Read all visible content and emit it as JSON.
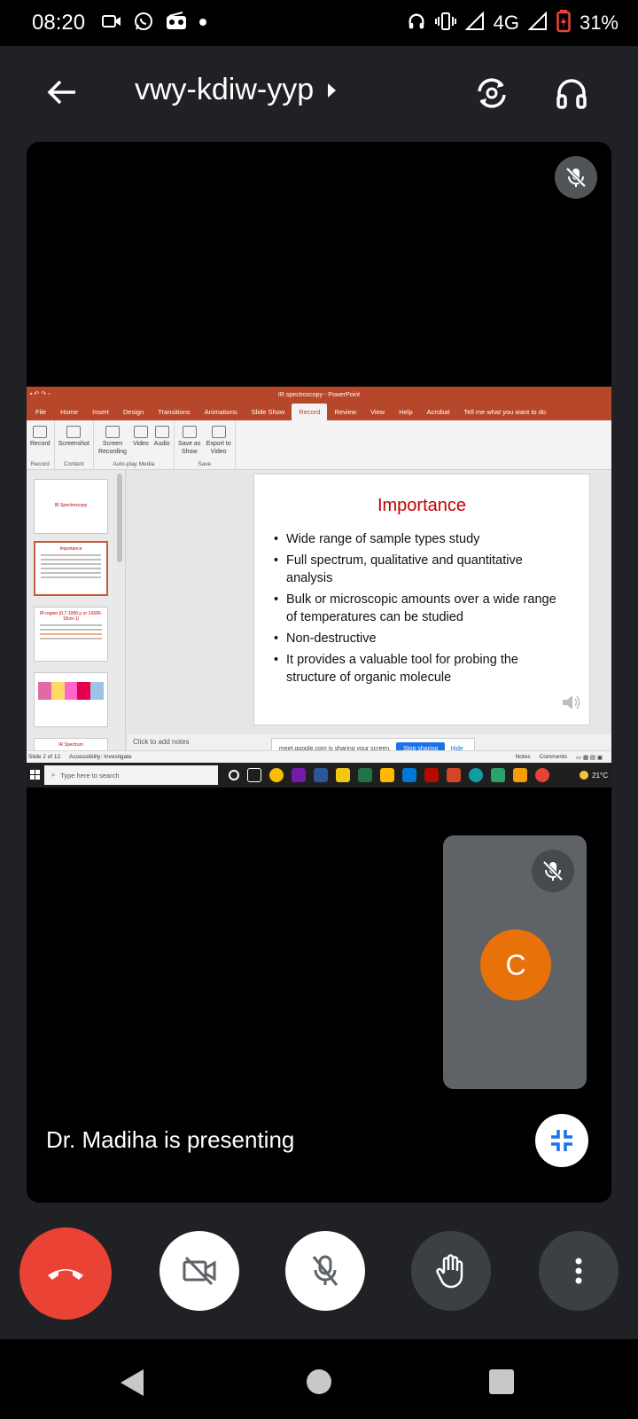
{
  "status": {
    "time": "08:20",
    "network": "4G",
    "battery": "31%"
  },
  "header": {
    "meeting_code": "vwy-kdiw-yyp"
  },
  "shared_screen": {
    "window_title": "IR spectroscopy  -  PowerPoint",
    "menu": [
      "File",
      "Home",
      "Insert",
      "Design",
      "Transitions",
      "Animations",
      "Slide Show",
      "Record",
      "Review",
      "View",
      "Help",
      "Acrobat",
      "Tell me what you want to do"
    ],
    "active_menu": "Record",
    "ribbon": {
      "groups": [
        {
          "label": "Record",
          "buttons": [
            "Record"
          ]
        },
        {
          "label": "Content",
          "buttons": [
            "Screenshot"
          ]
        },
        {
          "label": "Auto-play Media",
          "buttons": [
            "Screen Recording",
            "Video",
            "Audio"
          ]
        },
        {
          "label": "Save",
          "buttons": [
            "Save as Show",
            "Export to Video"
          ]
        }
      ]
    },
    "thumbs": [
      {
        "title": "IR Spectroscopy"
      },
      {
        "title": "Importance"
      },
      {
        "title": "IR region (0.7-1000 μ or 14300-10cm-1)"
      },
      {
        "title": ""
      },
      {
        "title": "IR Spectrum"
      }
    ],
    "slide": {
      "title": "Importance",
      "bullets": [
        " Wide range of sample types study",
        "Full spectrum, qualitative and quantitative analysis",
        " Bulk or microscopic amounts over a wide range of temperatures can be studied",
        "Non-destructive",
        " It provides a valuable tool for probing the structure of organic molecule"
      ]
    },
    "notes_placeholder": "Click to add notes",
    "sharing_text": "meet.google.com is sharing your screen.",
    "stop_sharing": "Stop sharing",
    "hide": "Hide",
    "status_slide": "Slide 2 of 12",
    "status_accessibility": "Accessibility: Investigate",
    "status_notes": "Notes",
    "status_comments": "Comments",
    "taskbar_search": "Type here to search",
    "temperature": "21°C"
  },
  "self_tile": {
    "avatar_letter": "C"
  },
  "presenting_label": "Dr. Madiha is presenting",
  "colors": {
    "end_call": "#ea4335",
    "avatar": "#e8710a",
    "slide_title": "#c00000"
  }
}
